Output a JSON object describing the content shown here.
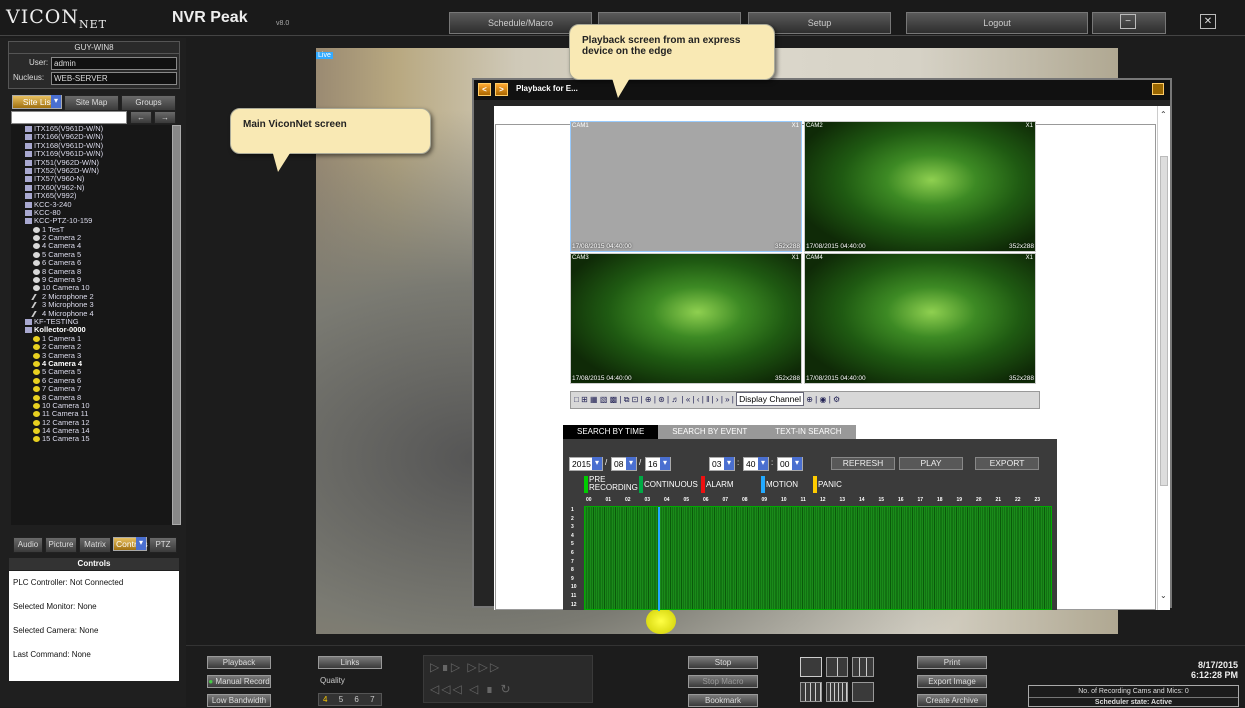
{
  "app": {
    "logo": "VICON",
    "logo_sub": "NET",
    "name": "NVR Peak",
    "version": "v8.0"
  },
  "top_buttons": {
    "schedule": "Schedule/Macro",
    "setup": "Setup",
    "logout": "Logout",
    "minimize": "−",
    "close": "✕"
  },
  "server": {
    "name": "GUY-WIN8",
    "user_label": "User:",
    "user": "admin",
    "nucleus_label": "Nucleus:",
    "nucleus": "WEB-SERVER"
  },
  "site_tabs": [
    "Site List",
    "Site Map",
    "Groups"
  ],
  "tree": [
    {
      "label": "ITX165(V961D-W/N)",
      "icon": "device"
    },
    {
      "label": "ITX166(V962D-W/N)",
      "icon": "device"
    },
    {
      "label": "ITX168(V961D-W/N)",
      "icon": "device"
    },
    {
      "label": "ITX169(V961D-W/N)",
      "icon": "device"
    },
    {
      "label": "ITX51(V962D-W/N)",
      "icon": "device"
    },
    {
      "label": "ITX52(V962D-W/N)",
      "icon": "device"
    },
    {
      "label": "ITX57(V960-N)",
      "icon": "device"
    },
    {
      "label": "ITX60(V962-N)",
      "icon": "device"
    },
    {
      "label": "ITX65(V992)",
      "icon": "device"
    },
    {
      "label": "KCC-3-240",
      "icon": "device"
    },
    {
      "label": "KCC-80",
      "icon": "device"
    },
    {
      "label": "KCC-PTZ-10-159",
      "icon": "device"
    },
    {
      "label": "1 TesT",
      "icon": "camera",
      "indent": 1
    },
    {
      "label": "2 Camera 2",
      "icon": "camera",
      "indent": 1
    },
    {
      "label": "4 Camera 4",
      "icon": "camera",
      "indent": 1
    },
    {
      "label": "5 Camera 5",
      "icon": "camera",
      "indent": 1
    },
    {
      "label": "6 Camera 6",
      "icon": "camera",
      "indent": 1
    },
    {
      "label": "8 Camera 8",
      "icon": "camera",
      "indent": 1
    },
    {
      "label": "9 Camera 9",
      "icon": "camera",
      "indent": 1
    },
    {
      "label": "10 Camera 10",
      "icon": "camera",
      "indent": 1
    },
    {
      "label": "2 Microphone 2",
      "icon": "mic",
      "indent": 1
    },
    {
      "label": "3 Microphone 3",
      "icon": "mic",
      "indent": 1
    },
    {
      "label": "4 Microphone 4",
      "icon": "mic",
      "indent": 1
    },
    {
      "label": "KF-TESTING",
      "icon": "device"
    },
    {
      "label": "Kollector-0000",
      "icon": "device",
      "bold": true
    },
    {
      "label": "1 Camera 1",
      "icon": "yellow",
      "indent": 1
    },
    {
      "label": "2 Camera 2",
      "icon": "yellow",
      "indent": 1
    },
    {
      "label": "3 Camera 3",
      "icon": "yellow",
      "indent": 1
    },
    {
      "label": "4 Camera 4",
      "icon": "yellow",
      "indent": 1,
      "bold": true
    },
    {
      "label": "5 Camera 5",
      "icon": "yellow",
      "indent": 1
    },
    {
      "label": "6 Camera 6",
      "icon": "yellow",
      "indent": 1
    },
    {
      "label": "7 Camera 7",
      "icon": "yellow",
      "indent": 1
    },
    {
      "label": "8 Camera 8",
      "icon": "yellow",
      "indent": 1
    },
    {
      "label": "10 Camera 10",
      "icon": "yellow",
      "indent": 1
    },
    {
      "label": "11 Camera 11",
      "icon": "yellow",
      "indent": 1
    },
    {
      "label": "12 Camera 12",
      "icon": "yellow",
      "indent": 1
    },
    {
      "label": "14 Camera 14",
      "icon": "yellow",
      "indent": 1
    },
    {
      "label": "15 Camera 15",
      "icon": "yellow",
      "indent": 1
    }
  ],
  "bottom_tabs": [
    "Audio",
    "Picture",
    "Matrix",
    "Controls",
    "PTZ"
  ],
  "controls": {
    "title": "Controls",
    "rows": [
      {
        "k": "PLC Controller:",
        "v": "Not Connected"
      },
      {
        "k": "Selected Monitor:",
        "v": "None"
      },
      {
        "k": "Selected Camera:",
        "v": "None"
      },
      {
        "k": "Last Command:",
        "v": "None"
      }
    ]
  },
  "video": {
    "live_tag": "Live"
  },
  "callouts": {
    "main": "Main ViconNet screen",
    "playback": "Playback screen from an express device on the edge"
  },
  "playback": {
    "title": "Playback for E...",
    "cams": [
      {
        "label": "CAM1",
        "ts": "17/08/2015 04:40:00",
        "res": "352x288",
        "zoom": "X1",
        "feed": "gray"
      },
      {
        "label": "CAM2",
        "ts": "17/08/2015 04:40:00",
        "res": "352x288",
        "zoom": "X1",
        "feed": "plants"
      },
      {
        "label": "CAM3",
        "ts": "17/08/2015 04:40:00",
        "res": "352x288",
        "zoom": "X1",
        "feed": "plants"
      },
      {
        "label": "CAM4",
        "ts": "17/08/2015 04:40:00",
        "res": "352x288",
        "zoom": "X1",
        "feed": "plants"
      }
    ],
    "display_channel": "Display Channel",
    "search_tabs": [
      "SEARCH BY TIME",
      "SEARCH BY EVENT",
      "TEXT-IN SEARCH"
    ],
    "date": {
      "year": "2015",
      "month": "08",
      "day": "16"
    },
    "time": {
      "h": "03",
      "m": "40",
      "s": "00"
    },
    "buttons": [
      "REFRESH",
      "PLAY",
      "EXPORT"
    ],
    "legend": [
      {
        "label": "PRE RECORDING",
        "color": "#00cc00"
      },
      {
        "label": "CONTINUOUS",
        "color": "#00aa44"
      },
      {
        "label": "ALARM",
        "color": "#ee1111"
      },
      {
        "label": "MOTION",
        "color": "#22aaff"
      },
      {
        "label": "PANIC",
        "color": "#ffcc00"
      }
    ],
    "hours": [
      "00",
      "01",
      "02",
      "03",
      "04",
      "05",
      "06",
      "07",
      "08",
      "09",
      "10",
      "11",
      "12",
      "13",
      "14",
      "15",
      "16",
      "17",
      "18",
      "19",
      "20",
      "21",
      "22",
      "23"
    ],
    "rows": [
      "1",
      "2",
      "3",
      "4",
      "5",
      "6",
      "7",
      "8",
      "9",
      "10",
      "11",
      "12"
    ]
  },
  "bottom": {
    "playback": "Playback",
    "links": "Links",
    "manual_record": "Manual Record",
    "quality": "Quality",
    "low_bandwidth": "Low Bandwidth",
    "quality_levels": [
      "4",
      "5",
      "6",
      "7"
    ],
    "stop": "Stop",
    "stop_macro": "Stop Macro",
    "bookmark": "Bookmark",
    "print": "Print",
    "export_image": "Export Image",
    "create_archive": "Create Archive",
    "date": "8/17/2015",
    "time": "6:12:28 PM",
    "recording_cams": "No. of Recording Cams and Mics: 0",
    "scheduler": "Scheduler state: Active"
  }
}
